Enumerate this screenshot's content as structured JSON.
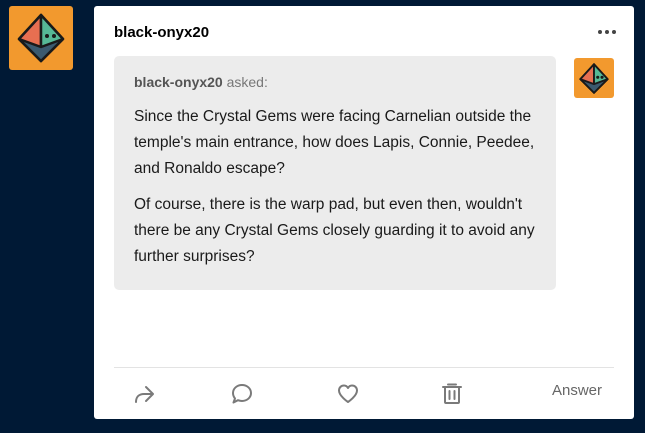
{
  "blog": {
    "name": "black-onyx20",
    "avatar_icon": "octahedron-gem-avatar-icon",
    "avatar_bg": "#f2992e"
  },
  "header": {
    "more_icon": "more-options-icon"
  },
  "ask": {
    "asker": "black-onyx20",
    "asked_label": "asked:",
    "paragraphs": [
      "Since the Crystal Gems were facing Carnelian outside the temple's main entrance, how does Lapis, Connie, Peedee, and Ronaldo escape?",
      "Of course, there is the warp pad, but even then, wouldn't there be any Crystal Gems closely guarding it to avoid any further surprises?"
    ]
  },
  "footer": {
    "share_icon": "share-icon",
    "reply_icon": "reply-icon",
    "like_icon": "heart-icon",
    "delete_icon": "delete-icon",
    "answer_label": "Answer"
  },
  "colors": {
    "background": "#001935",
    "card": "#ffffff",
    "bubble": "#ececec",
    "accent": "#f2992e"
  }
}
